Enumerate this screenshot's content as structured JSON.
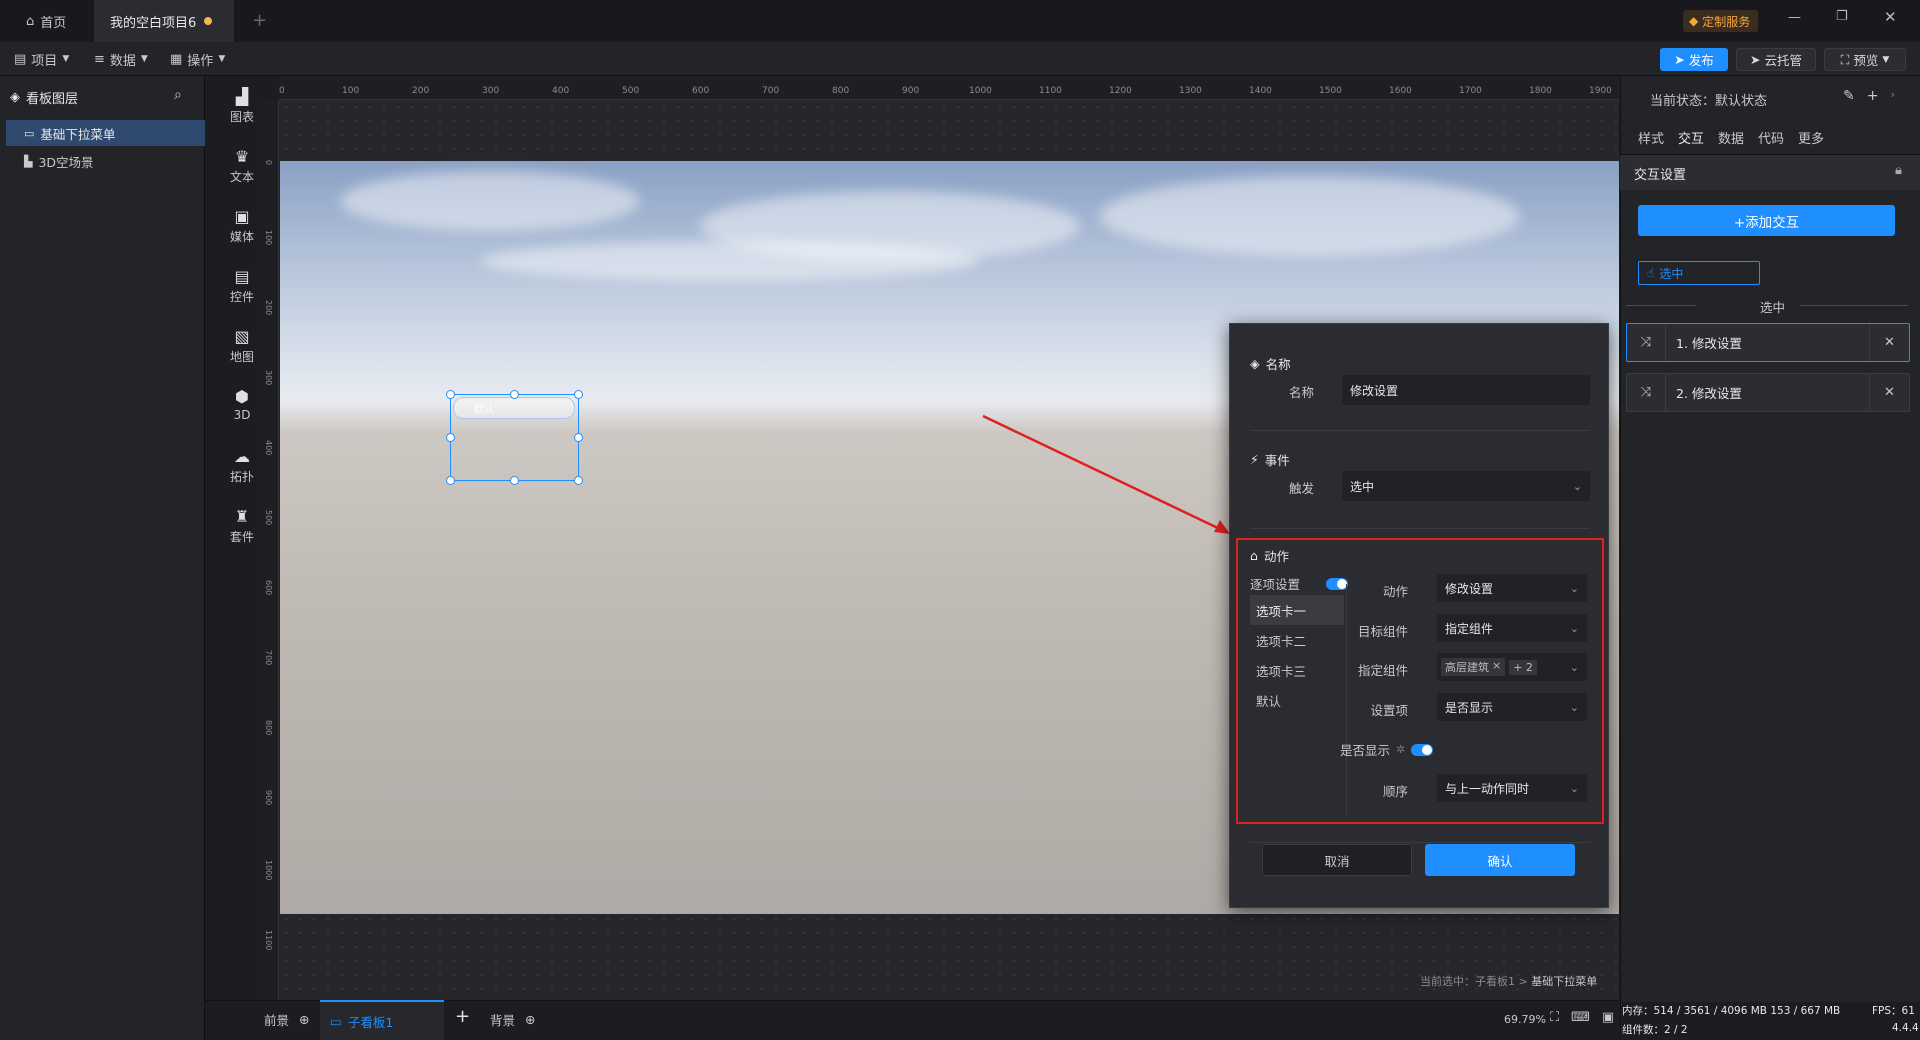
{
  "titlebar": {
    "home_tab": "首页",
    "project_tab": "我的空白项目6",
    "custom_service": "定制服务"
  },
  "menubar": {
    "project": "项目",
    "data": "数据",
    "operation": "操作",
    "publish": "发布",
    "cloud_host": "云托管",
    "preview": "预览"
  },
  "left_panel": {
    "title": "看板图层",
    "layers": [
      "基础下拉菜单",
      "3D空场景"
    ]
  },
  "iconbar": [
    "图表",
    "文本",
    "媒体",
    "控件",
    "地图",
    "3D",
    "拓扑",
    "套件"
  ],
  "ruler": {
    "top": [
      "0",
      "100",
      "200",
      "300",
      "400",
      "500",
      "600",
      "700",
      "800",
      "900",
      "1000",
      "1100",
      "1200",
      "1300",
      "1400",
      "1500",
      "1600",
      "1700",
      "1800",
      "1900"
    ],
    "left": [
      "0",
      "100",
      "200",
      "300",
      "400",
      "500",
      "600",
      "700",
      "800",
      "900",
      "1000",
      "1100"
    ]
  },
  "widget": {
    "default_text": "默认"
  },
  "dialog": {
    "name_section": "名称",
    "name_label": "名称",
    "name_value": "修改设置",
    "event_section": "事件",
    "trigger_label": "触发",
    "trigger_value": "选中",
    "action_section": "动作",
    "per_option_label": "逐项设置",
    "options": [
      "选项卡一",
      "选项卡二",
      "选项卡三",
      "默认"
    ],
    "action_label": "动作",
    "action_value": "修改设置",
    "target_label": "目标组件",
    "target_value": "指定组件",
    "specified_label": "指定组件",
    "specified_tag": "高层建筑",
    "specified_more": "+ 2",
    "setting_label": "设置项",
    "setting_value": "是否显示",
    "visible_label": "是否显示",
    "order_label": "顺序",
    "order_value": "与上一动作同时",
    "cancel": "取消",
    "confirm": "确认"
  },
  "right_panel": {
    "state_prefix": "当前状态：",
    "state_value": "默认状态",
    "tabs": [
      "样式",
      "交互",
      "数据",
      "代码",
      "更多"
    ],
    "section_title": "交互设置",
    "add_button": "+添加交互",
    "event_chip": "选中",
    "divider_label": "选中",
    "items": [
      "1. 修改设置",
      "2. 修改设置"
    ]
  },
  "bottom": {
    "foreground": "前景",
    "sub_board": "子看板1",
    "background": "背景",
    "selection_prefix": "当前选中：子看板1 > ",
    "selection_value": "基础下拉菜单",
    "zoom": "69.79%"
  },
  "status": {
    "memory": "内存：514 / 3561 / 4096 MB  153 / 667 MB",
    "fps": "FPS：61",
    "components": "组件数：2 / 2",
    "version": "4.4.4"
  },
  "colors": {
    "accent": "#1f8fff",
    "highlight_box": "#e02020"
  }
}
